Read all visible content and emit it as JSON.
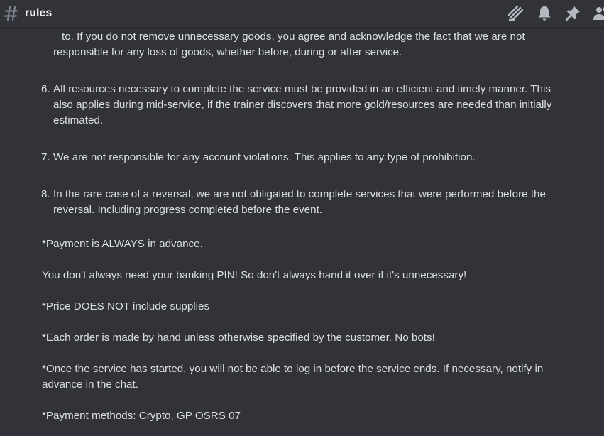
{
  "header": {
    "channel_name": "rules",
    "icons": [
      "threads-icon",
      "bell-icon",
      "pin-icon",
      "members-icon"
    ]
  },
  "colors": {
    "background": "#313338",
    "text": "#dbdee1",
    "header_text": "#f2f3f5",
    "icon": "#b5bac1"
  },
  "rules": {
    "item5_cont": {
      "l1": "to. If you do not remove unnecessary goods, you agree and acknowledge the fact that we are not",
      "l2": "responsible for any loss of goods, whether before, during or after service."
    },
    "item6": {
      "number": "6.",
      "l1": "All resources necessary to complete the service must be provided in an efficient and timely manner. This",
      "l2": "also applies during mid-service, if the trainer discovers that more gold/resources are needed than initially",
      "l3": "estimated."
    },
    "item7": {
      "number": "7.",
      "l1": "We are not responsible for any account violations. This applies to any type of prohibition."
    },
    "item8": {
      "number": "8.",
      "l1": "In the rare case of a reversal, we are not obligated to complete services that were performed before the",
      "l2": "reversal. Including progress completed before the event."
    }
  },
  "notes": {
    "payment": "*Payment is ALWAYS in advance.",
    "pin": "You don't always need your banking PIN! So don't always hand it over if it's unnecessary!",
    "price": "*Price DOES NOT include supplies",
    "hand": "*Each order is made by hand unless otherwise specified by the customer. No bots!",
    "login_l1": "*Once the service has started, you will not be able to log in before the service ends. If necessary, notify in",
    "login_l2": "advance in the chat.",
    "methods": "*Payment methods: Crypto, GP OSRS 07"
  }
}
